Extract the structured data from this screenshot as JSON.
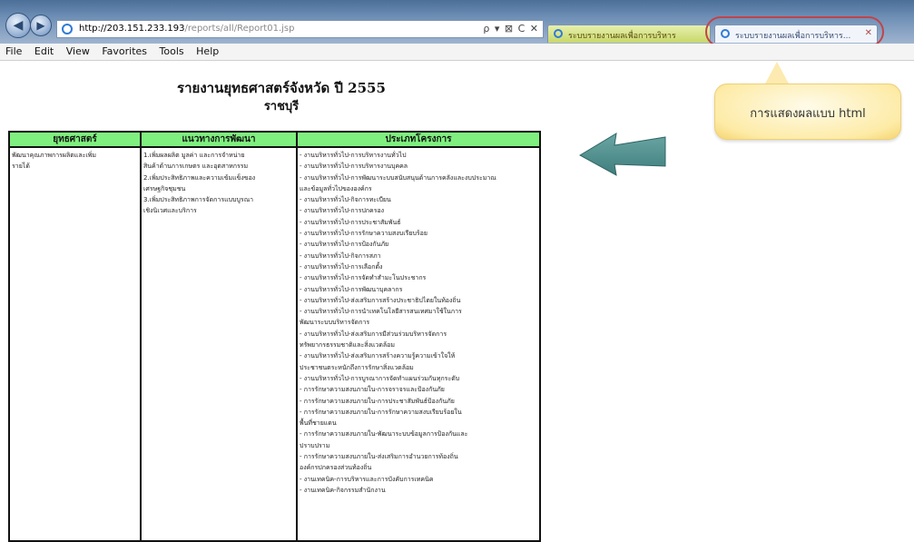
{
  "browser": {
    "url_host": "http://203.151.233.193",
    "url_path": "/reports/all/Report01.jsp",
    "address_tools": "ρ ▾ ⊠ C ✕",
    "tabs": [
      {
        "label": "ระบบรายงานผลเพื่อการบริหาร"
      },
      {
        "label": "ระบบรายงานผลเพื่อการบริหาร..."
      }
    ],
    "tab_close": "✕"
  },
  "menu": [
    "File",
    "Edit",
    "View",
    "Favorites",
    "Tools",
    "Help"
  ],
  "report": {
    "title": "รายงานยุทธศาสตร์จังหวัด ปี 2555",
    "subtitle": "ราชบุรี",
    "columns": [
      "ยุทธศาสตร์",
      "แนวทางการพัฒนา",
      "ประเภทโครงการ"
    ],
    "strategy": [
      "พัฒนาคุณภาพการผลิตและเพิ่ม",
      "รายได้"
    ],
    "guidelines": [
      "1.เพิ่มผลผลิต มูลค่า และการจำหน่าย",
      "สินค้าด้านการเกษตร และอุตสาหกรรม",
      "2.เพิ่มประสิทธิภาพและความเข้มแข็งของ",
      "เศรษฐกิจชุมชน",
      "3.เพิ่มประสิทธิภาพการจัดการแบบบูรณา",
      "เชิงนิเวศและบริการ"
    ],
    "projects": [
      "- งานบริหารทั่วไป-การบริหารงานทั่วไป",
      "- งานบริหารทั่วไป-การบริหารงานบุคคล",
      "- งานบริหารทั่วไป-การพัฒนาระบบสนับสนุนด้านการคลังและงบประมาณ",
      "และข้อมูลทั่วไปขององค์กร",
      "- งานบริหารทั่วไป-กิจการทะเบียน",
      "- งานบริหารทั่วไป-การปกครอง",
      "- งานบริหารทั่วไป-การประชาสัมพันธ์",
      "- งานบริหารทั่วไป-การรักษาความสงบเรียบร้อย",
      "- งานบริหารทั่วไป-การป้องกันภัย",
      "- งานบริหารทั่วไป-กิจการสภา",
      "- งานบริหารทั่วไป-การเลือกตั้ง",
      "- งานบริหารทั่วไป-การจัดทำสำมะโนประชากร",
      "- งานบริหารทั่วไป-การพัฒนาบุคลากร",
      "- งานบริหารทั่วไป-ส่งเสริมการสร้างประชาธิปไตยในท้องถิ่น",
      "- งานบริหารทั่วไป-การนำเทคโนโลยีสารสนเทศมาใช้ในการ",
      "พัฒนาระบบบริหารจัดการ",
      "- งานบริหารทั่วไป-ส่งเสริมการมีส่วนร่วมบริหารจัดการ",
      "ทรัพยากรธรรมชาติและสิ่งแวดล้อม",
      "- งานบริหารทั่วไป-ส่งเสริมการสร้างความรู้ความเข้าใจให้",
      "ประชาชนตระหนักถึงการรักษาสิ่งแวดล้อม",
      "- งานบริหารทั่วไป-การบูรณาการจัดทำแผนร่วมกันทุกระดับ",
      "- การรักษาความสงบภายใน-การจราจรและป้องกันภัย",
      "- การรักษาความสงบภายใน-การประชาสัมพันธ์ป้องกันภัย",
      "- การรักษาความสงบภายใน-การรักษาความสงบเรียบร้อยใน",
      "พื้นที่ชายแดน",
      "- การรักษาความสงบภายใน-พัฒนาระบบข้อมูลการป้องกันและ",
      "ปราบปราม",
      "- การรักษาความสงบภายใน-ส่งเสริมการอำนวยการท้องถิ่น",
      "องค์กรปกครองส่วนท้องถิ่น",
      "- งานเทคนิค-การบริหารและการบังคับการเทคนิค",
      "- งานเทคนิค-กิจกรรมสำนักงาน"
    ]
  },
  "annotation": {
    "callout_text": "การแสดงผลแบบ html"
  },
  "colors": {
    "header_green": "#7ff07f",
    "callout_yellow": "#fdeba6",
    "arrow_teal": "#4f8f8e",
    "highlight_red": "#c1444a"
  }
}
